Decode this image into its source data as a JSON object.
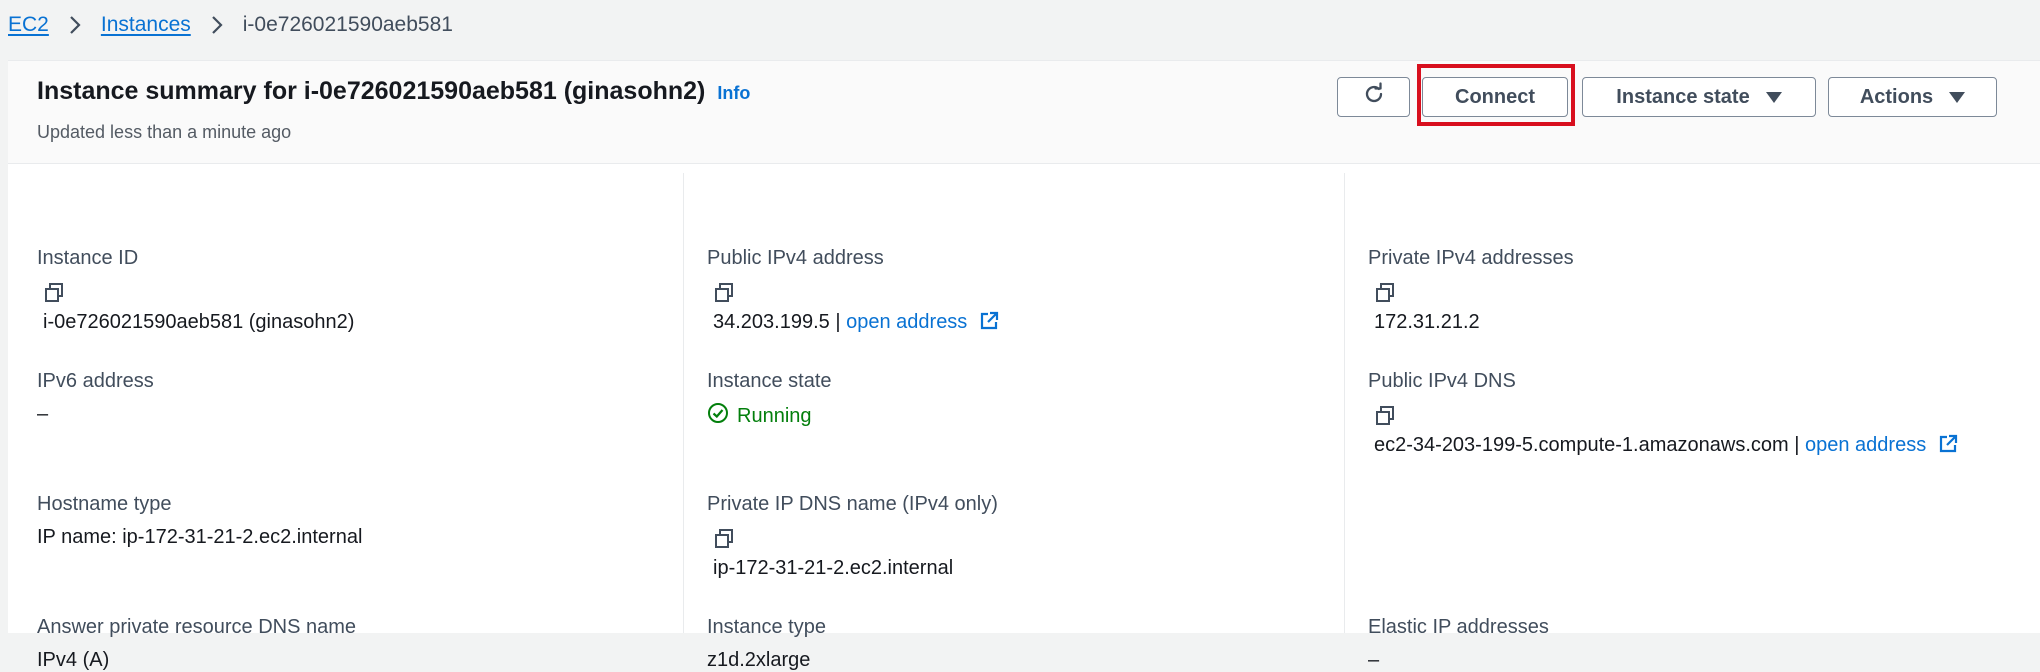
{
  "breadcrumb": {
    "items": [
      "EC2",
      "Instances"
    ],
    "current": "i-0e726021590aeb581"
  },
  "header": {
    "title": "Instance summary for i-0e726021590aeb581 (ginasohn2)",
    "info_label": "Info",
    "subtitle": "Updated less than a minute ago"
  },
  "toolbar": {
    "refresh_icon": "refresh-icon",
    "connect_label": "Connect",
    "instance_state_label": "Instance state",
    "actions_label": "Actions"
  },
  "details": {
    "instance_id": {
      "label": "Instance ID",
      "value": "i-0e726021590aeb581 (ginasohn2)"
    },
    "ipv6": {
      "label": "IPv6 address",
      "value": "–"
    },
    "hostname_type": {
      "label": "Hostname type",
      "value": "IP name: ip-172-31-21-2.ec2.internal"
    },
    "answer_dns": {
      "label": "Answer private resource DNS name",
      "value": "IPv4 (A)"
    },
    "public_ipv4": {
      "label": "Public IPv4 address",
      "value": "34.203.199.5",
      "separator": "|",
      "link": "open address"
    },
    "instance_state": {
      "label": "Instance state",
      "value": "Running"
    },
    "private_dns": {
      "label": "Private IP DNS name (IPv4 only)",
      "value": "ip-172-31-21-2.ec2.internal"
    },
    "instance_type": {
      "label": "Instance type",
      "value": "z1d.2xlarge"
    },
    "private_ipv4": {
      "label": "Private IPv4 addresses",
      "value": "172.31.21.2"
    },
    "public_dns": {
      "label": "Public IPv4 DNS",
      "value": "ec2-34-203-199-5.compute-1.amazonaws.com",
      "separator": "|",
      "link": "open address"
    },
    "elastic_ip": {
      "label": "Elastic IP addresses",
      "value": "–"
    }
  },
  "colors": {
    "link": "#0972d3",
    "running": "#037f0c",
    "highlight": "#d80f1e"
  }
}
